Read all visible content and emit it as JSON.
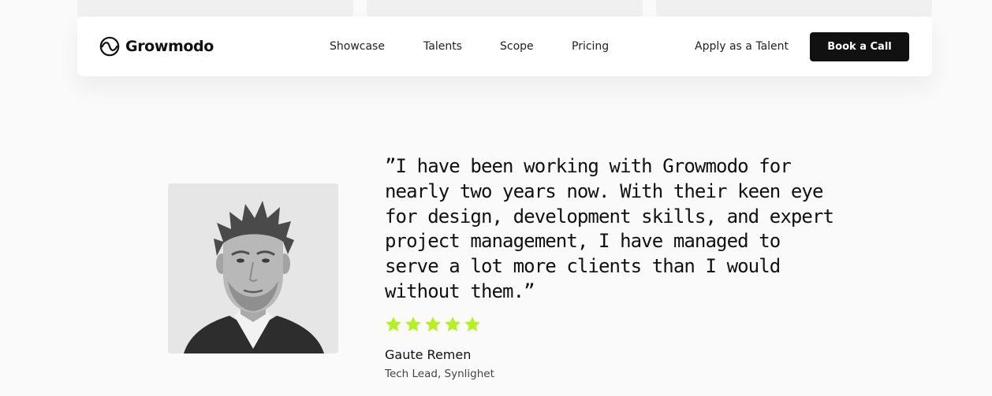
{
  "brand": {
    "name": "Growmodo",
    "logo_icon": "growmodo-logo-icon"
  },
  "nav": {
    "links": [
      {
        "label": "Showcase"
      },
      {
        "label": "Talents"
      },
      {
        "label": "Scope"
      },
      {
        "label": "Pricing"
      }
    ],
    "apply_label": "Apply as a Talent",
    "cta_label": "Book a Call"
  },
  "testimonial": {
    "quote_lines": [
      "”I have been working with Growmodo for",
      "nearly two years now. With their keen eye",
      "for design, development skills, and expert",
      "project management, I have managed to",
      "serve a lot more clients than I would",
      "without them.”"
    ],
    "rating": 5,
    "rating_max": 5,
    "author_name": "Gaute Remen",
    "author_role": "Tech Lead, Synlighet",
    "photo_icon": "person-portrait"
  },
  "colors": {
    "accent_star": "#b5f21d",
    "cta_background": "#111111",
    "page_background": "#fafafa"
  }
}
